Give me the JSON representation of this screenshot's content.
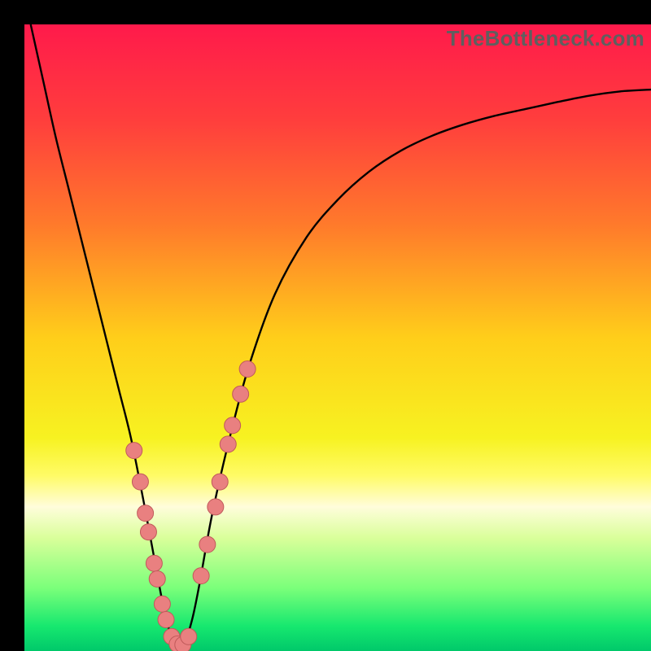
{
  "watermark": "TheBottleneck.com",
  "chart_data": {
    "type": "line",
    "title": "",
    "xlabel": "",
    "ylabel": "",
    "xlim": [
      0,
      100
    ],
    "ylim": [
      0,
      100
    ],
    "grid": false,
    "legend": false,
    "gradient_stops": [
      {
        "offset": 0.0,
        "color": "#ff1a4b"
      },
      {
        "offset": 0.15,
        "color": "#ff3d3d"
      },
      {
        "offset": 0.32,
        "color": "#ff7a2b"
      },
      {
        "offset": 0.5,
        "color": "#ffce1a"
      },
      {
        "offset": 0.66,
        "color": "#f7f221"
      },
      {
        "offset": 0.72,
        "color": "#fffb66"
      },
      {
        "offset": 0.77,
        "color": "#fffddb"
      },
      {
        "offset": 0.82,
        "color": "#d9ff9a"
      },
      {
        "offset": 0.9,
        "color": "#7aff7a"
      },
      {
        "offset": 0.96,
        "color": "#17e86f"
      },
      {
        "offset": 1.0,
        "color": "#00c96a"
      }
    ],
    "series": [
      {
        "name": "bottleneck-curve",
        "stroke": "#000000",
        "x": [
          1,
          3,
          5,
          7,
          9,
          11,
          13,
          15,
          17,
          19,
          20.5,
          22,
          23.2,
          24,
          24.8,
          25.5,
          26.2,
          27,
          28,
          30,
          33,
          36,
          40,
          45,
          50,
          55,
          60,
          65,
          70,
          75,
          80,
          85,
          90,
          95,
          100
        ],
        "y": [
          100,
          91,
          82,
          74,
          66,
          58,
          50,
          42,
          34,
          24,
          16,
          8,
          3,
          1.2,
          0.8,
          1.2,
          3,
          6,
          11,
          22,
          35,
          46,
          57,
          66,
          72,
          76.5,
          79.8,
          82.2,
          84.0,
          85.4,
          86.5,
          87.6,
          88.6,
          89.3,
          89.6
        ]
      }
    ],
    "marker_groups": [
      {
        "name": "left-cluster",
        "color": "#e98080",
        "stroke": "#c05a5a",
        "radius": 10,
        "points": [
          {
            "x": 17.5,
            "y": 32
          },
          {
            "x": 18.5,
            "y": 27
          },
          {
            "x": 19.3,
            "y": 22
          },
          {
            "x": 19.8,
            "y": 19
          },
          {
            "x": 20.7,
            "y": 14
          },
          {
            "x": 21.2,
            "y": 11.5
          },
          {
            "x": 22.0,
            "y": 7.5
          },
          {
            "x": 22.6,
            "y": 5
          },
          {
            "x": 23.5,
            "y": 2.3
          },
          {
            "x": 24.4,
            "y": 1.1
          },
          {
            "x": 25.3,
            "y": 1.0
          },
          {
            "x": 26.2,
            "y": 2.3
          }
        ]
      },
      {
        "name": "right-cluster",
        "color": "#e98080",
        "stroke": "#c05a5a",
        "radius": 10,
        "points": [
          {
            "x": 28.2,
            "y": 12
          },
          {
            "x": 29.2,
            "y": 17
          },
          {
            "x": 30.5,
            "y": 23
          },
          {
            "x": 31.2,
            "y": 27
          },
          {
            "x": 32.5,
            "y": 33
          },
          {
            "x": 33.2,
            "y": 36
          },
          {
            "x": 34.5,
            "y": 41
          },
          {
            "x": 35.6,
            "y": 45
          }
        ]
      }
    ]
  }
}
